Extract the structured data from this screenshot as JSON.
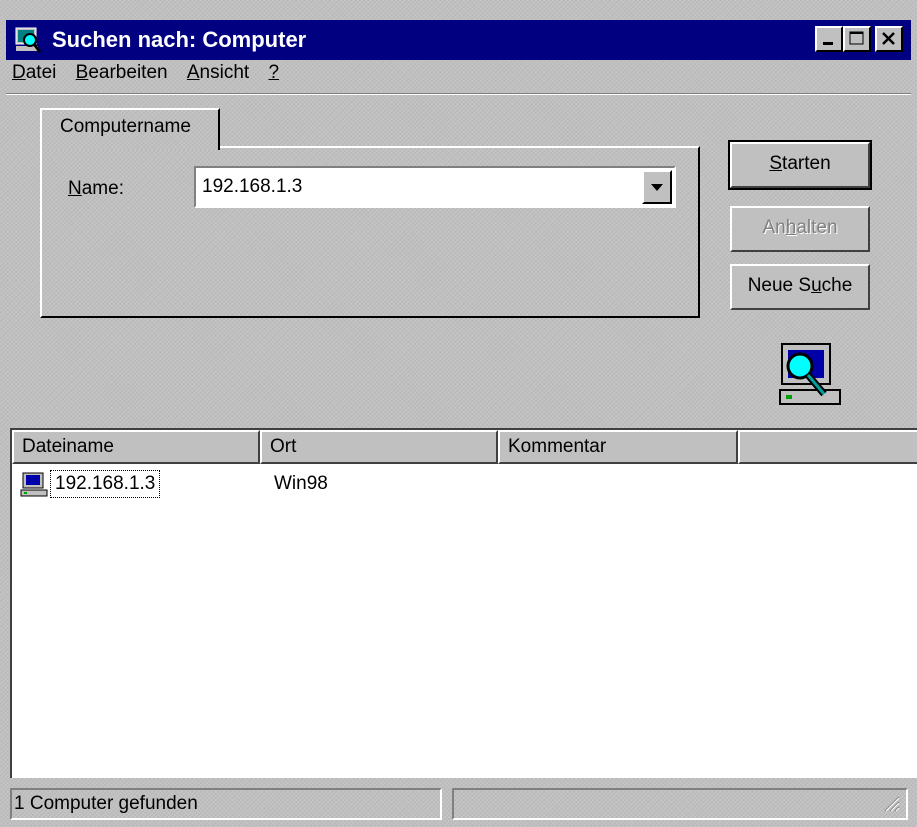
{
  "window": {
    "title": "Suchen nach: Computer"
  },
  "menu": {
    "items": [
      {
        "pre": "",
        "key": "D",
        "post": "atei"
      },
      {
        "pre": "",
        "key": "B",
        "post": "earbeiten"
      },
      {
        "pre": "",
        "key": "A",
        "post": "nsicht"
      },
      {
        "pre": "",
        "key": "?",
        "post": ""
      }
    ]
  },
  "tab": {
    "label": "Computername"
  },
  "name_field": {
    "label_key": "N",
    "label_rest": "ame:",
    "value": "192.168.1.3"
  },
  "buttons": {
    "start": {
      "key": "S",
      "rest": "tarten"
    },
    "stop": {
      "pre": "An",
      "key": "h",
      "rest": "alten"
    },
    "new": {
      "pre": "Neue S",
      "key": "u",
      "rest": "che"
    }
  },
  "list": {
    "columns": [
      "Dateiname",
      "Ort",
      "Kommentar",
      ""
    ],
    "rows": [
      {
        "name": "192.168.1.3",
        "ort": "Win98",
        "kommentar": ""
      }
    ]
  },
  "status": {
    "text": "1 Computer gefunden"
  },
  "icons": {
    "title": "computer-search-icon",
    "large": "computer-search-icon",
    "row": "computer-icon"
  },
  "colors": {
    "titlebar": "#000080",
    "face": "#c0c0c0"
  }
}
